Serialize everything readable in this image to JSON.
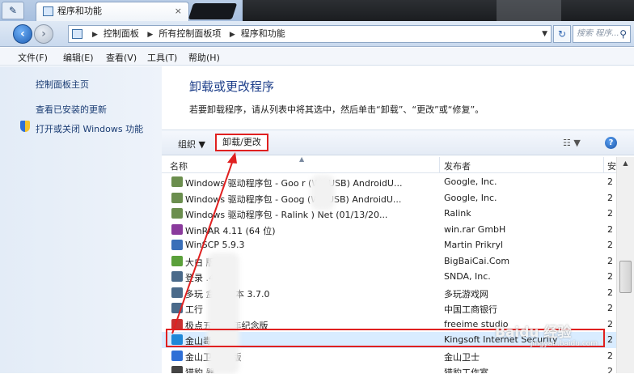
{
  "window": {
    "tab_title": "程序和功能",
    "tab_close": "×"
  },
  "address": {
    "crumbs": [
      "控制面板",
      "所有控制面板项",
      "程序和功能"
    ],
    "search_placeholder": "搜索 程序..."
  },
  "menu": [
    "文件(F)",
    "编辑(E)",
    "查看(V)",
    "工具(T)",
    "帮助(H)"
  ],
  "sidebar": {
    "items": [
      {
        "label": "控制面板主页"
      },
      {
        "label": "查看已安装的更新"
      },
      {
        "label": "打开或关闭 Windows 功能"
      }
    ]
  },
  "main": {
    "title": "卸载或更改程序",
    "subtitle": "若要卸载程序，请从列表中将其选中，然后单击“卸载”、“更改”或“修复”。"
  },
  "toolbar": {
    "organize_label": "组织 ▼",
    "uninstall_label": "卸载/更改",
    "view_label": "☷ ▼",
    "help_label": "?"
  },
  "table": {
    "columns": [
      "名称",
      "发布者",
      "安"
    ],
    "rows": [
      {
        "name": "Windows 驱动程序包 - Goo         r (WinUSB) AndroidU...",
        "publisher": "Google, Inc.",
        "date": "2",
        "icon_color": "#6b8e4e"
      },
      {
        "name": "Windows 驱动程序包 - Goog        (WinUSB) AndroidU...",
        "publisher": "Google, Inc.",
        "date": "2",
        "icon_color": "#6b8e4e"
      },
      {
        "name": "Windows 驱动程序包 - Ralink        ) Net  (01/13/20...",
        "publisher": "Ralink",
        "date": "2",
        "icon_color": "#6b8e4e"
      },
      {
        "name": "WinRAR 4.11 (64 位)",
        "publisher": "win.rar GmbH",
        "date": "2",
        "icon_color": "#8a3a9c"
      },
      {
        "name": "WinSCP 5.9.3",
        "publisher": "Martin Prikryl",
        "date": "2",
        "icon_color": "#3a6fb8"
      },
      {
        "name": "大白         版",
        "publisher": "BigBaiCai.Com",
        "date": "2",
        "icon_color": "#5aa03a"
      },
      {
        "name": "登录          .4.6.1",
        "publisher": "SNDA, Inc.",
        "date": "2",
        "icon_color": "#4a6a8a"
      },
      {
        "name": "多玩        盒子 版本 3.7.0",
        "publisher": "多玩游戏网",
        "date": "2",
        "icon_color": "#4a6a8a"
      },
      {
        "name": "工行",
        "publisher": "中国工商银行",
        "date": "2",
        "icon_color": "#4a6a8a"
      },
      {
        "name": "极点五     十周年纪念版",
        "publisher": "freeime studio",
        "date": "2",
        "icon_color": "#c83030"
      },
      {
        "name": "金山毒霸",
        "publisher": "Kingsoft Internet Security",
        "date": "2",
        "icon_color": "#1e88d8"
      },
      {
        "name": "金山卫         正式版",
        "publisher": "金山卫士",
        "date": "2",
        "icon_color": "#2f6fd6"
      },
      {
        "name": "猎豹          器",
        "publisher": "猎豹工作室",
        "date": "2",
        "icon_color": "#444444"
      }
    ]
  },
  "watermark": {
    "brand": "Baidu 经验",
    "url": "jingyan.baidu.com"
  },
  "colors": {
    "annotation": "#e02020",
    "link": "#1b3d74",
    "title": "#1e3f8a"
  }
}
